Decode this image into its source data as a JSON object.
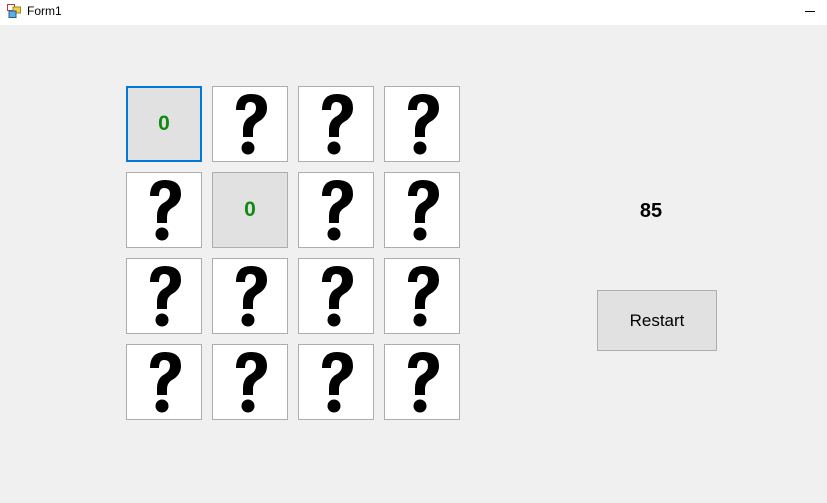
{
  "window": {
    "title": "Form1"
  },
  "tiles": [
    {
      "state": "revealed",
      "value": "0",
      "focused": true
    },
    {
      "state": "hidden",
      "value": ""
    },
    {
      "state": "hidden",
      "value": ""
    },
    {
      "state": "hidden",
      "value": ""
    },
    {
      "state": "hidden",
      "value": ""
    },
    {
      "state": "revealed",
      "value": "0",
      "focused": false
    },
    {
      "state": "hidden",
      "value": ""
    },
    {
      "state": "hidden",
      "value": ""
    },
    {
      "state": "hidden",
      "value": ""
    },
    {
      "state": "hidden",
      "value": ""
    },
    {
      "state": "hidden",
      "value": ""
    },
    {
      "state": "hidden",
      "value": ""
    },
    {
      "state": "hidden",
      "value": ""
    },
    {
      "state": "hidden",
      "value": ""
    },
    {
      "state": "hidden",
      "value": ""
    },
    {
      "state": "hidden",
      "value": ""
    }
  ],
  "hidden_icon": "question-mark-icon",
  "colors": {
    "revealed_value": "#118a11",
    "focus_border": "#0078d7"
  },
  "score": "85",
  "restart_label": "Restart"
}
